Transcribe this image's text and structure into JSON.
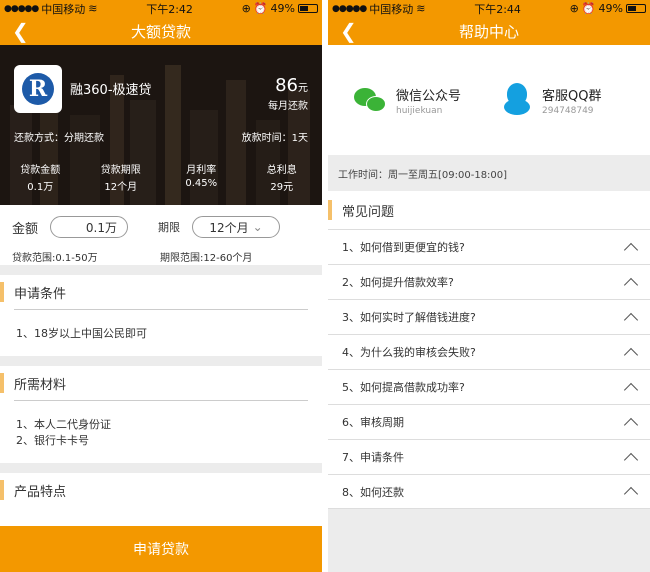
{
  "left": {
    "status": {
      "carrier": "中国移动",
      "time": "下午2:42",
      "battery": "49%"
    },
    "nav": {
      "title": "大额贷款",
      "back_icon": "chevron-left-icon"
    },
    "banner": {
      "product_name": "融360-极速贷",
      "monthly_amount": "86",
      "monthly_unit": "元",
      "monthly_label": "每月还款",
      "repay_method": "还款方式：分期还款",
      "disburse_time": "放款时间：1天",
      "stats": [
        {
          "label": "贷款金额",
          "value": "0.1万"
        },
        {
          "label": "贷款期限",
          "value": "12个月"
        },
        {
          "label": "月利率",
          "value": "0.45%"
        },
        {
          "label": "总利息",
          "value": "29元"
        }
      ]
    },
    "form": {
      "amount_label": "金额",
      "amount_value": "0.1万",
      "term_label": "期限",
      "term_value": "12个月",
      "amount_range": "贷款范围:0.1-50万",
      "term_range": "期限范围:12-60个月"
    },
    "sections": {
      "conditions_title": "申请条件",
      "conditions_items": [
        "1、18岁以上中国公民即可"
      ],
      "materials_title": "所需材料",
      "materials_items": [
        "1、本人二代身份证",
        "2、银行卡卡号"
      ],
      "features_title": "产品特点"
    },
    "apply_button": "申请贷款"
  },
  "right": {
    "status": {
      "carrier": "中国移动",
      "time": "下午2:44",
      "battery": "49%"
    },
    "nav": {
      "title": "帮助中心",
      "back_icon": "chevron-left-icon"
    },
    "contacts": [
      {
        "name": "微信公众号",
        "sub": "huijiekuan",
        "icon": "wechat-icon"
      },
      {
        "name": "客服QQ群",
        "sub": "294748749",
        "icon": "qq-icon"
      }
    ],
    "worktime": "工作时间：周一至周五[09:00-18:00]",
    "faq_title": "常见问题",
    "faq": [
      "1、如何借到更便宜的钱?",
      "2、如何提升借款效率?",
      "3、如何实时了解借钱进度?",
      "4、为什么我的审核会失败?",
      "5、如何提高借款成功率?",
      "6、审核周期",
      "7、申请条件",
      "8、如何还款"
    ]
  },
  "colors": {
    "accent": "#f39800",
    "section_marker": "#f5c06a"
  }
}
